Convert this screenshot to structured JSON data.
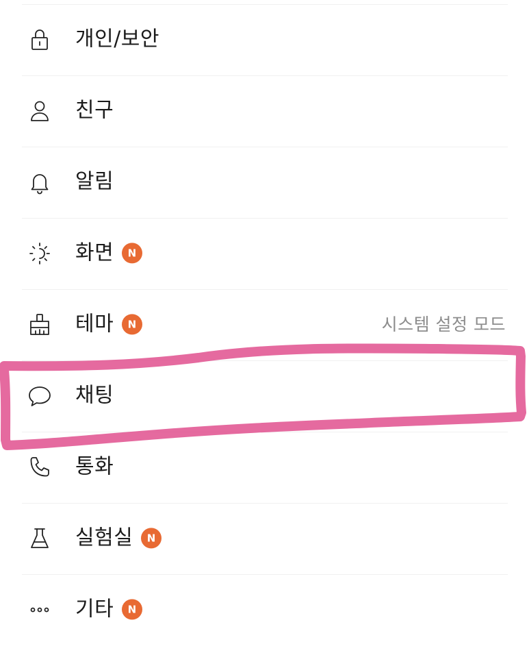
{
  "colors": {
    "badge": "#e86a33",
    "highlight": "#e0508e",
    "divider": "#f0f0f0",
    "text": "#1b1b1b",
    "secondary_text": "#8c8c8c"
  },
  "settings_menu": {
    "items": [
      {
        "label": "개인/보안",
        "icon": "lock-icon",
        "new_badge": false
      },
      {
        "label": "친구",
        "icon": "person-icon",
        "new_badge": false
      },
      {
        "label": "알림",
        "icon": "bell-icon",
        "new_badge": false
      },
      {
        "label": "화면",
        "icon": "brightness-icon",
        "new_badge": true,
        "badge_text": "N"
      },
      {
        "label": "테마",
        "icon": "paintbrush-icon",
        "new_badge": true,
        "badge_text": "N",
        "value": "시스템 설정 모드"
      },
      {
        "label": "채팅",
        "icon": "chat-bubble-icon",
        "new_badge": false,
        "highlighted": true
      },
      {
        "label": "통화",
        "icon": "phone-icon",
        "new_badge": false
      },
      {
        "label": "실험실",
        "icon": "flask-icon",
        "new_badge": true,
        "badge_text": "N"
      },
      {
        "label": "기타",
        "icon": "more-icon",
        "new_badge": true,
        "badge_text": "N"
      }
    ]
  }
}
